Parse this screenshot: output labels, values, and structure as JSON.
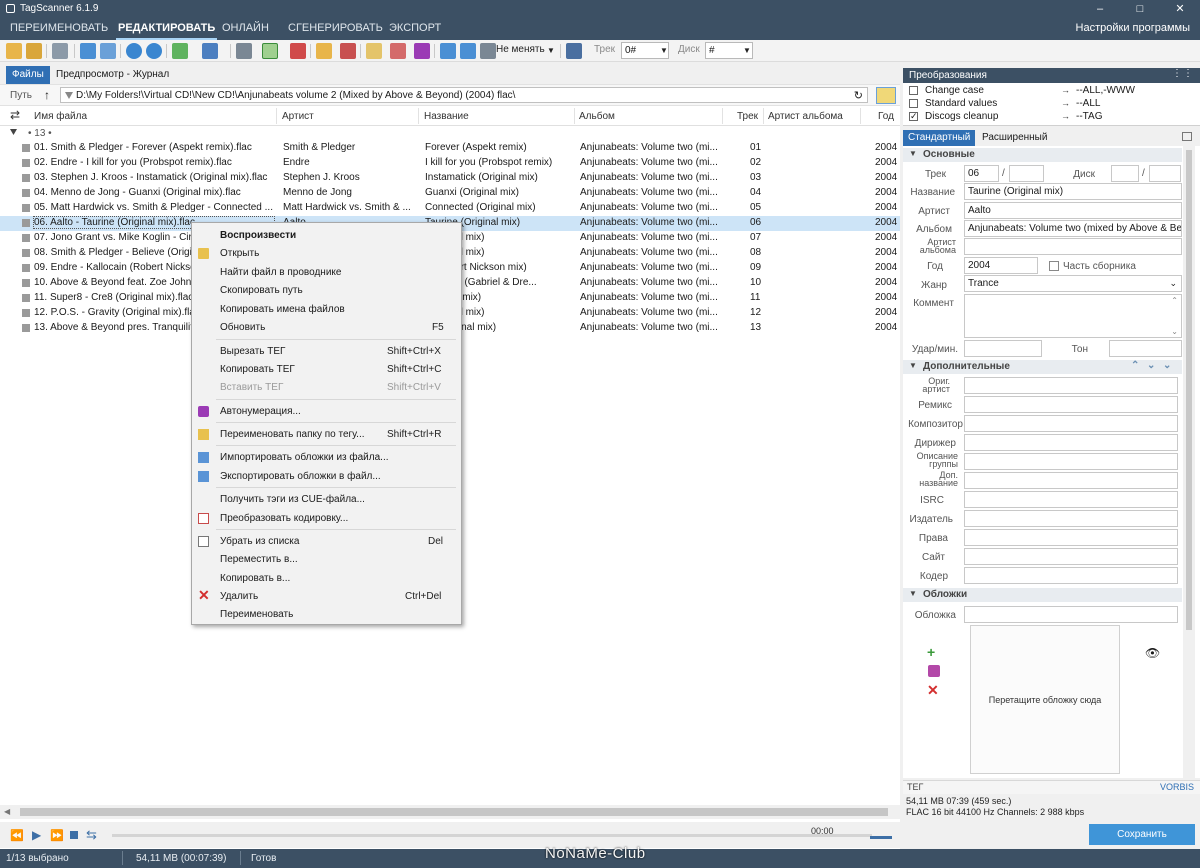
{
  "app": {
    "title": "TagScanner 6.1.9",
    "settings_label": "Настройки программы"
  },
  "menu": [
    "ПЕРЕИМЕНОВАТЬ",
    "РЕДАКТИРОВАТЬ",
    "ОНЛАЙН",
    "СГЕНЕРИРОВАТЬ",
    "ЭКСПОРТ"
  ],
  "toolbar": {
    "mode_value": "Не менять",
    "track_label": "Трек",
    "track_value": "0#",
    "disc_label": "Диск",
    "disc_value": "#"
  },
  "tabs": {
    "files": "Файлы",
    "preview": "Предпросмотр - Журнал"
  },
  "path": {
    "label": "Путь",
    "value": "D:\\My Folders!\\Virtual CD!\\New CD!\\Anjunabeats volume 2 (Mixed by Above & Beyond) (2004) flac\\"
  },
  "columns": {
    "filename": "Имя файла",
    "artist": "Артист",
    "title": "Название",
    "album": "Альбом",
    "track": "Трек",
    "album_artist": "Артист альбома",
    "year": "Год"
  },
  "group_label": "13",
  "rows": [
    {
      "file": "01. Smith & Pledger - Forever (Aspekt remix).flac",
      "artist": "Smith & Pledger",
      "title": "Forever (Aspekt remix)",
      "album": "Anjunabeats: Volume two (mi...",
      "track": "01",
      "year": "2004"
    },
    {
      "file": "02. Endre - I kill for you (Probspot remix).flac",
      "artist": "Endre",
      "title": "I kill for you (Probspot remix)",
      "album": "Anjunabeats: Volume two (mi...",
      "track": "02",
      "year": "2004"
    },
    {
      "file": "03. Stephen J. Kroos - Instamatick (Original mix).flac",
      "artist": "Stephen J. Kroos",
      "title": "Instamatick (Original mix)",
      "album": "Anjunabeats: Volume two (mi...",
      "track": "03",
      "year": "2004"
    },
    {
      "file": "04. Menno de Jong - Guanxi (Original mix).flac",
      "artist": "Menno de Jong",
      "title": "Guanxi (Original mix)",
      "album": "Anjunabeats: Volume two (mi...",
      "track": "04",
      "year": "2004"
    },
    {
      "file": "05. Matt Hardwick vs. Smith & Pledger - Connected ...",
      "artist": "Matt Hardwick vs. Smith & ...",
      "title": "Connected (Original mix)",
      "album": "Anjunabeats: Volume two (mi...",
      "track": "05",
      "year": "2004"
    },
    {
      "file": "06. Aalto - Taurine (Original mix).flac",
      "artist": "Aalto",
      "title": "Taurine (Original mix)",
      "album": "Anjunabeats: Volume two (mi...",
      "track": "06",
      "year": "2004"
    },
    {
      "file": "07. Jono Grant vs. Mike Koglin - Circ",
      "artist": "",
      "title": "(Original mix)",
      "album": "Anjunabeats: Volume two (mi...",
      "track": "07",
      "year": "2004"
    },
    {
      "file": "08. Smith & Pledger - Believe (Origi",
      "artist": "",
      "title": "(Original mix)",
      "album": "Anjunabeats: Volume two (mi...",
      "track": "08",
      "year": "2004"
    },
    {
      "file": "09. Endre - Kallocain (Robert Nickso",
      "artist": "",
      "title": "n (Robert Nickson mix)",
      "album": "Anjunabeats: Volume two (mi...",
      "track": "09",
      "year": "2004"
    },
    {
      "file": "10. Above & Beyond feat. Zoe Johns",
      "artist": "",
      "title": "on earth (Gabriel & Dre...",
      "album": "Anjunabeats: Volume two (mi...",
      "track": "10",
      "year": "2004"
    },
    {
      "file": "11. Super8 - Cre8 (Original mix).flac",
      "artist": "",
      "title": "Original mix)",
      "album": "Anjunabeats: Volume two (mi...",
      "track": "11",
      "year": "2004"
    },
    {
      "file": "12. P.O.S. - Gravity (Original mix).fla",
      "artist": "",
      "title": "(Original mix)",
      "album": "Anjunabeats: Volume two (mi...",
      "track": "12",
      "year": "2004"
    },
    {
      "file": "13. Above & Beyond pres. Tranquilit",
      "artist": "",
      "title": "er (Original mix)",
      "album": "Anjunabeats: Volume two (mi...",
      "track": "13",
      "year": "2004"
    }
  ],
  "context_menu": {
    "play": "Воспроизвести",
    "open": "Открыть",
    "find_in_explorer": "Найти файл в проводнике",
    "copy_path": "Скопировать путь",
    "copy_names": "Копировать имена файлов",
    "refresh": "Обновить",
    "refresh_key": "F5",
    "cut_tag": "Вырезать ТЕГ",
    "cut_tag_key": "Shift+Ctrl+X",
    "copy_tag": "Копировать ТЕГ",
    "copy_tag_key": "Shift+Ctrl+C",
    "paste_tag": "Вставить ТЕГ",
    "paste_tag_key": "Shift+Ctrl+V",
    "autonumber": "Автонумерация...",
    "rename_folder": "Переименовать папку по тегу...",
    "rename_folder_key": "Shift+Ctrl+R",
    "import_covers": "Импортировать обложки из файла...",
    "export_covers": "Экспортировать обложки в файл...",
    "cue_tags": "Получить тэги из CUE-файла...",
    "convert_encoding": "Преобразовать кодировку...",
    "remove": "Убрать из списка",
    "remove_key": "Del",
    "move": "Переместить в...",
    "copy_to": "Копировать в...",
    "delete": "Удалить",
    "delete_key": "Ctrl+Del",
    "rename": "Переименовать"
  },
  "transforms": {
    "title": "Преобразования",
    "items": [
      {
        "label": "Change case",
        "value": "--ALL,-WWW",
        "checked": false
      },
      {
        "label": "Standard values",
        "value": "--ALL",
        "checked": false
      },
      {
        "label": "Discogs cleanup",
        "value": "--TAG",
        "checked": true
      }
    ]
  },
  "editor": {
    "tab_standard": "Стандартный",
    "tab_extended": "Расширенный",
    "section_basic": "Основные",
    "section_extra": "Дополнительные",
    "section_covers": "Обложки",
    "labels": {
      "track": "Трек",
      "disc": "Диск",
      "title": "Название",
      "artist": "Артист",
      "album": "Альбом",
      "album_artist": "Артист альбома",
      "year": "Год",
      "compilation": "Часть сборника",
      "genre": "Жанр",
      "comment": "Коммент",
      "bpm": "Удар/мин.",
      "key": "Тон",
      "orig_artist": "Ориг. артист",
      "remixer": "Ремикс",
      "composer": "Композитор",
      "conductor": "Дирижер",
      "group_desc": "Описание группы",
      "subtitle": "Доп. название",
      "isrc": "ISRC",
      "publisher": "Издатель",
      "copyright": "Права",
      "website": "Сайт",
      "encoder": "Кодер",
      "cover": "Обложка"
    },
    "values": {
      "track": "06",
      "title": "Taurine (Original mix)",
      "artist": "Aalto",
      "album": "Anjunabeats: Volume two (mixed by Above & Bey",
      "year": "2004",
      "genre": "Trance"
    },
    "drop_cover": "Перетащите обложку сюда",
    "tag_label": "ТЕГ",
    "tag_format": "VORBIS",
    "info_line1": "54,11 MB  07:39 (459 sec.)",
    "info_line2": "FLAC  16 bit  44100 Hz  Channels: 2  988 kbps",
    "save": "Сохранить"
  },
  "player": {
    "time": "00:00"
  },
  "status": {
    "selected": "1/13 выбрано",
    "size": "54,11 MB (00:07:39)",
    "state": "Готов"
  },
  "watermark": "NoNaMe-Club"
}
